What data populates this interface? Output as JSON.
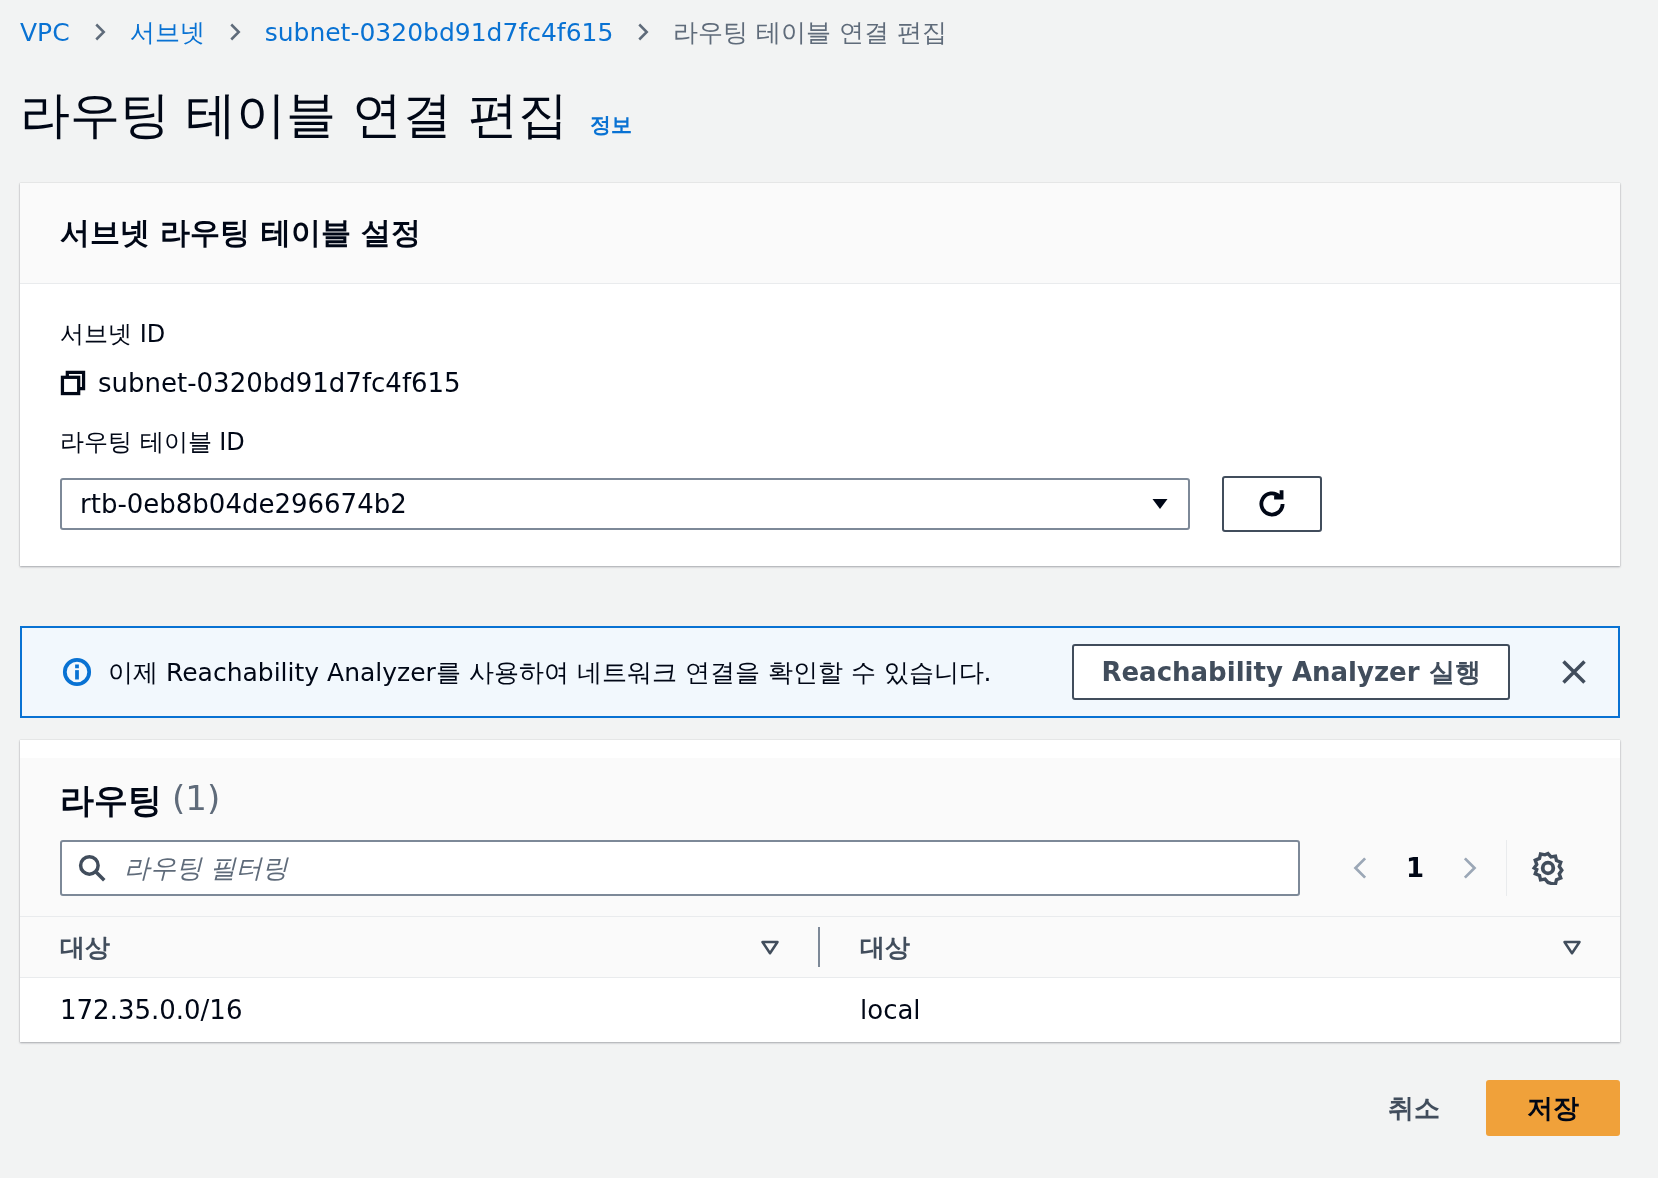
{
  "breadcrumbs": [
    {
      "label": "VPC",
      "link": true
    },
    {
      "label": "서브넷",
      "link": true
    },
    {
      "label": "subnet-0320bd91d7fc4f615",
      "link": true
    },
    {
      "label": "라우팅 테이블 연결 편집",
      "link": false
    }
  ],
  "page": {
    "title": "라우팅 테이블 연결 편집",
    "info_link": "정보"
  },
  "settings_panel": {
    "title": "서브넷 라우팅 테이블 설정",
    "subnet_label": "서브넷 ID",
    "subnet_value": "subnet-0320bd91d7fc4f615",
    "route_table_label": "라우팅 테이블 ID",
    "route_table_value": "rtb-0eb8b04de296674b2"
  },
  "alert": {
    "message": "이제 Reachability Analyzer를 사용하여 네트워크 연결을 확인할 수 있습니다.",
    "button": "Reachability Analyzer 실행"
  },
  "routes": {
    "title": "라우팅",
    "count": "(1)",
    "filter_placeholder": "라우팅 필터링",
    "pagination": {
      "prev_disabled": true,
      "next_disabled": true,
      "pages": [
        {
          "label": "1",
          "selected": true
        }
      ]
    },
    "columns": [
      "대상",
      "대상"
    ],
    "rows": [
      [
        "172.35.0.0/16",
        "local"
      ]
    ]
  },
  "footer": {
    "buttons": [
      {
        "label": "취소",
        "kind": "link"
      },
      {
        "label": "저장",
        "kind": "primary"
      }
    ]
  }
}
